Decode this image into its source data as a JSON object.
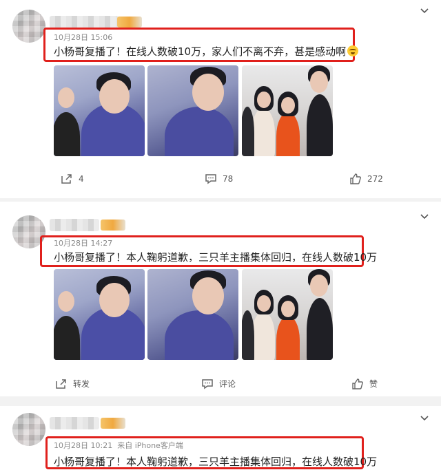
{
  "posts": [
    {
      "time": "10月28日 15:06",
      "source": "",
      "text": "小杨哥复播了！在线人数破10万，家人们不离不弃，甚是感动啊",
      "repost": "4",
      "comment": "78",
      "like": "272"
    },
    {
      "time": "10月28日 14:27",
      "source": "",
      "text": "小杨哥复播了！本人鞠躬道歉，三只羊主播集体回归，在线人数破10万",
      "repost": "转发",
      "comment": "评论",
      "like": "赞"
    },
    {
      "time": "10月28日 10:21",
      "source": "来自 iPhone客户端",
      "text": "小杨哥复播了！本人鞠躬道歉，三只羊主播集体回归，在线人数破10万"
    }
  ],
  "icons": {
    "expand": "chevron-down-icon",
    "repost": "share-icon",
    "comment": "comment-icon",
    "like": "thumbs-up-icon",
    "emoji": "laughing-emoji-icon"
  },
  "colors": {
    "highlight_border": "#e0201c",
    "background": "#f2f2f2",
    "card": "#ffffff"
  }
}
